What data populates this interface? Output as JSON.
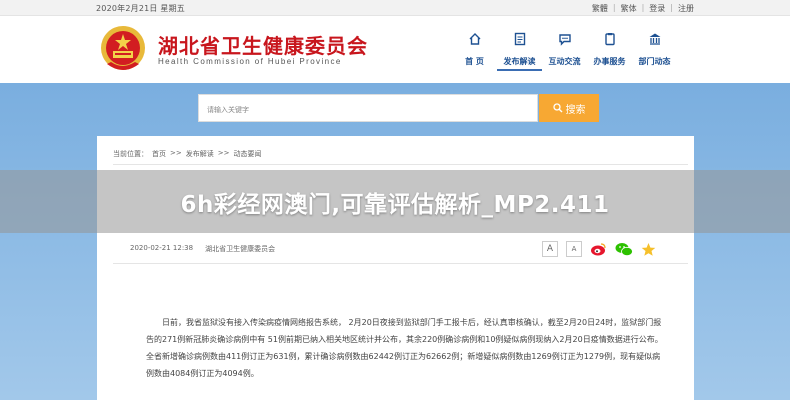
{
  "topbar": {
    "date": "2020年2月21日 星期五",
    "links": [
      "繁體",
      "繁体",
      "登录",
      "注册"
    ]
  },
  "header": {
    "title": "湖北省卫生健康委员会",
    "subtitle": "Health Commission of Hubei Province"
  },
  "nav": [
    {
      "label": "首 页",
      "icon": "home-icon"
    },
    {
      "label": "发布解读",
      "icon": "document-icon"
    },
    {
      "label": "互动交流",
      "icon": "chat-icon"
    },
    {
      "label": "办事服务",
      "icon": "clipboard-icon"
    },
    {
      "label": "部门动态",
      "icon": "building-icon"
    }
  ],
  "search": {
    "placeholder": "请输入关键字",
    "button": "搜索"
  },
  "breadcrumb": [
    "当前位置：",
    "首页",
    ">>",
    "发布解读",
    ">>",
    "动态要闻"
  ],
  "banner": {
    "title": "6h彩经网澳门,可靠评估解析_MP2.411"
  },
  "meta": {
    "datetime": "2020-02-21 12:38",
    "source": "湖北省卫生健康委员会"
  },
  "tools": [
    "A",
    "A"
  ],
  "article": {
    "text": "日前，我省监狱没有接入传染病疫情网络报告系统， 2月20日夜接到监狱部门手工报卡后，经认真审核确认，截至2月20日24时，监狱部门报告的271例新冠肺炎确诊病例中有 51例前期已纳入相关地区统计并公布，其余220例确诊病例和10例疑似病例现纳入2月20日疫情数据进行公布。全省新增确诊病例数由411例订正为631例，累计确诊病例数由62442例订正为62662例；新增疑似病例数由1269例订正为1279例，现有疑似病例数由4084例订正为4094例。"
  },
  "colors": {
    "brand_red": "#c8161d",
    "nav_blue": "#1e5192",
    "search_orange": "#f7a833",
    "band_blue": "#8ab9e4"
  }
}
